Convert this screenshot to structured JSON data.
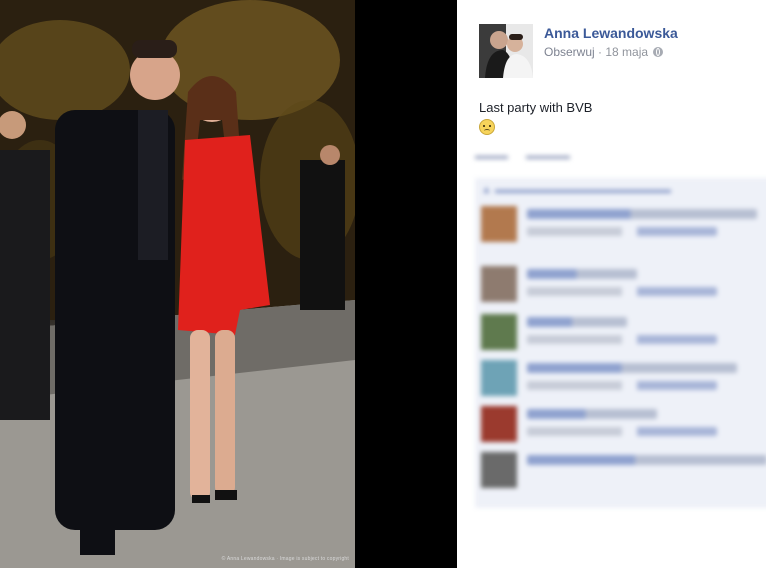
{
  "post": {
    "author_name": "Anna Lewandowska",
    "follow_label": "Obserwuj",
    "separator": "·",
    "date": "18 maja",
    "caption": "Last party with BVB",
    "photo_watermark": "© Anna Lewandowska · Image is subject to copyright"
  },
  "icons": {
    "privacy": "globe-icon",
    "emoji": "sad-emoji-icon"
  },
  "colors": {
    "author_link": "#3b5998",
    "meta_text": "#90949c",
    "comments_background": "#eef1f8"
  }
}
